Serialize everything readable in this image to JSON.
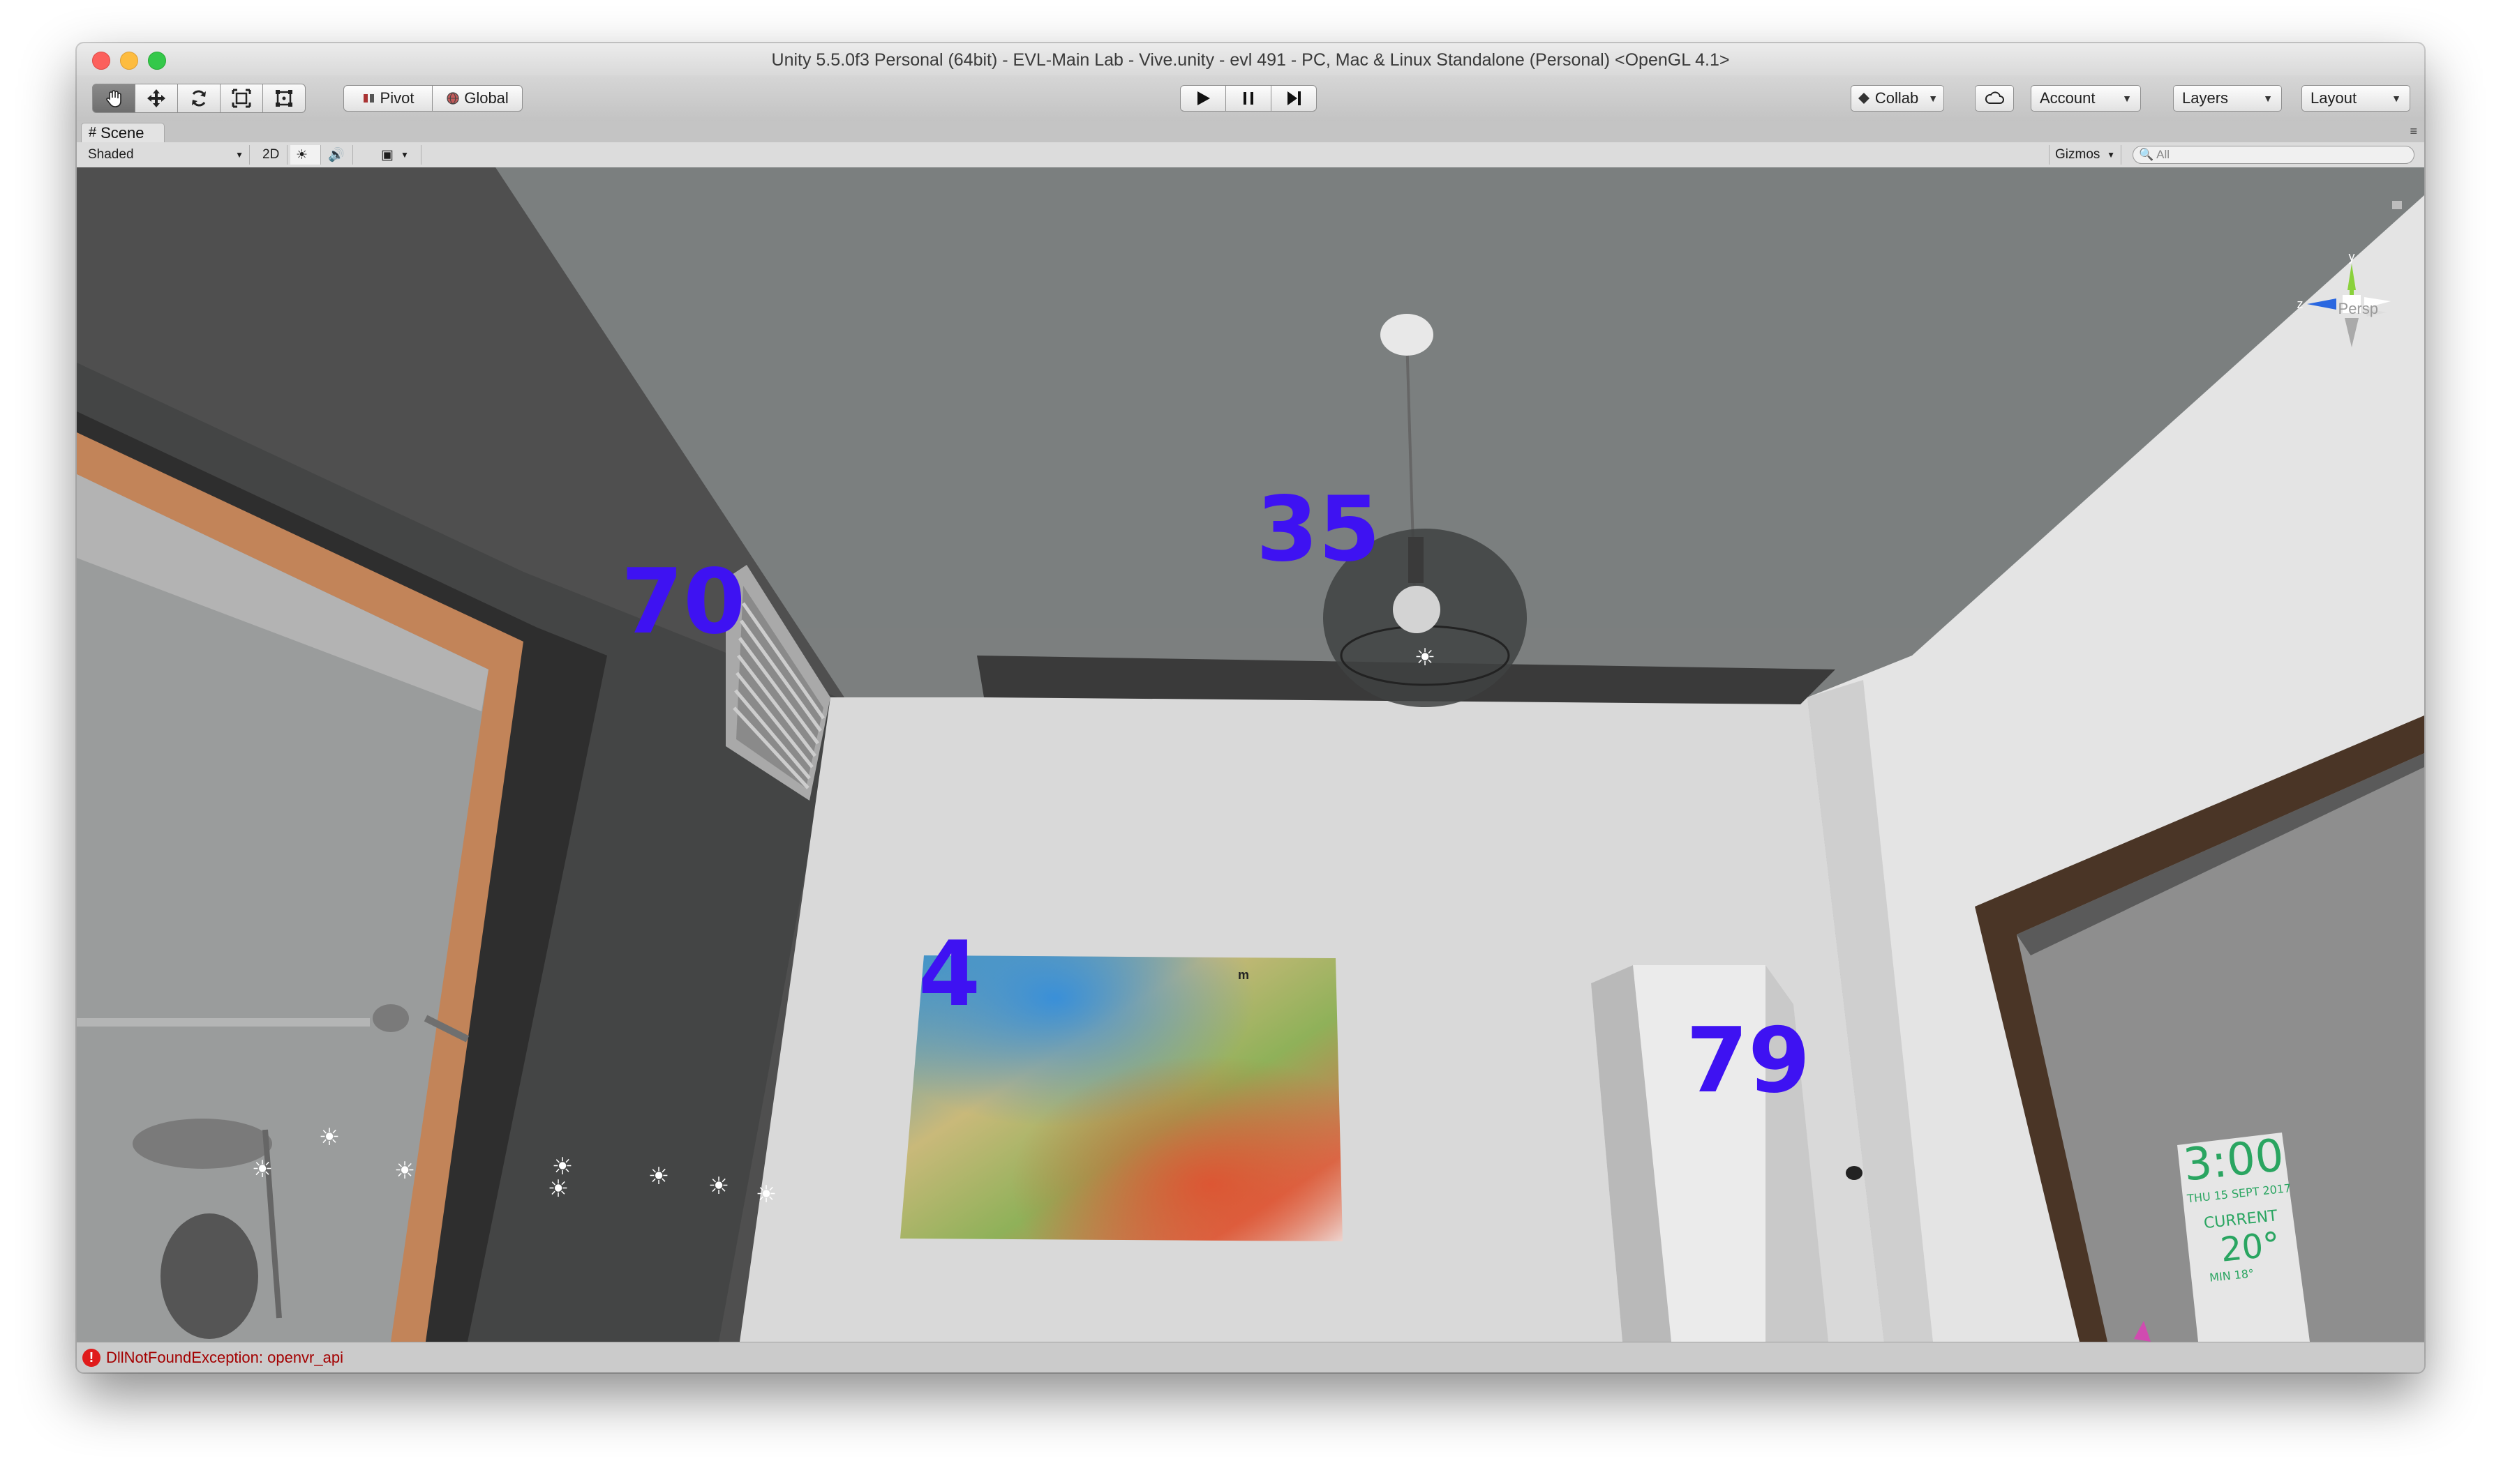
{
  "window": {
    "title": "Unity 5.5.0f3 Personal (64bit) - EVL-Main Lab - Vive.unity - evl 491 - PC, Mac & Linux Standalone (Personal) <OpenGL 4.1>"
  },
  "toolbar": {
    "tools": [
      "hand-icon",
      "move-icon",
      "rotate-icon",
      "scale-icon",
      "rect-icon"
    ],
    "pivot_label": "Pivot",
    "global_label": "Global",
    "play_icon": "play-icon",
    "pause_icon": "pause-icon",
    "step_icon": "step-icon",
    "collab_label": "Collab",
    "cloud_icon": "cloud-icon",
    "account_label": "Account",
    "layers_label": "Layers",
    "layout_label": "Layout"
  },
  "scene": {
    "tab_label": "Scene",
    "shading_mode": "Shaded",
    "mode_2d_label": "2D",
    "gizmos_label": "Gizmos",
    "search_placeholder": "All",
    "projection_label": "Persp",
    "overlay_numbers": [
      "70",
      "35",
      "4",
      "79"
    ],
    "clock": {
      "time": "3:00",
      "date": "THU 15 SEPT 2017",
      "status": "CURRENT",
      "temperature": "20°",
      "minimum": "MIN 18°"
    }
  },
  "status": {
    "error_message": "DllNotFoundException: openvr_api"
  },
  "colors": {
    "overlay_number": "#3e12f2",
    "error_text": "#a30000",
    "clock_text": "#2aa561"
  }
}
